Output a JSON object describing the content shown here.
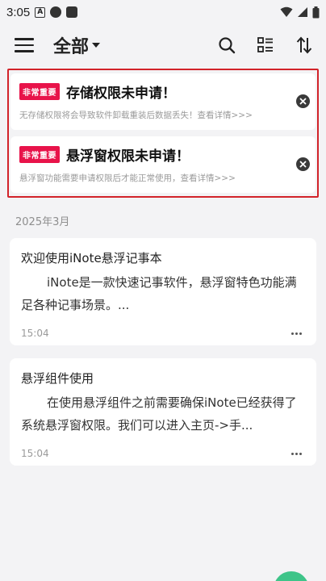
{
  "status_bar": {
    "time": "3:05",
    "notification_icon_letter": "A"
  },
  "app_bar": {
    "title": "全部",
    "icons": [
      "menu-icon",
      "search-icon",
      "view-toggle-icon",
      "sort-icon"
    ]
  },
  "alerts": [
    {
      "badge": "非常重要",
      "title": "存储权限未申请！",
      "desc": "无存储权限将会导致软件卸载重装后数据丢失！查看详情>>>"
    },
    {
      "badge": "非常重要",
      "title": "悬浮窗权限未申请！",
      "desc": "悬浮窗功能需要申请权限后才能正常使用，查看详情>>>"
    }
  ],
  "month_header": "2025年3月",
  "notes": [
    {
      "title": "欢迎使用iNote悬浮记事本",
      "body": "iNote是一款快速记事软件，悬浮窗特色功能满足各种记事场景。...",
      "time": "15:04"
    },
    {
      "title": "悬浮组件使用",
      "body": "在使用悬浮组件之前需要确保iNote已经获得了系统悬浮窗权限。我们可以进入主页->手...",
      "time": "15:04"
    }
  ],
  "colors": {
    "alert_border": "#d2232a",
    "badge": "#e8134a",
    "fab": "#3ec489",
    "background": "#f3f3f5"
  }
}
